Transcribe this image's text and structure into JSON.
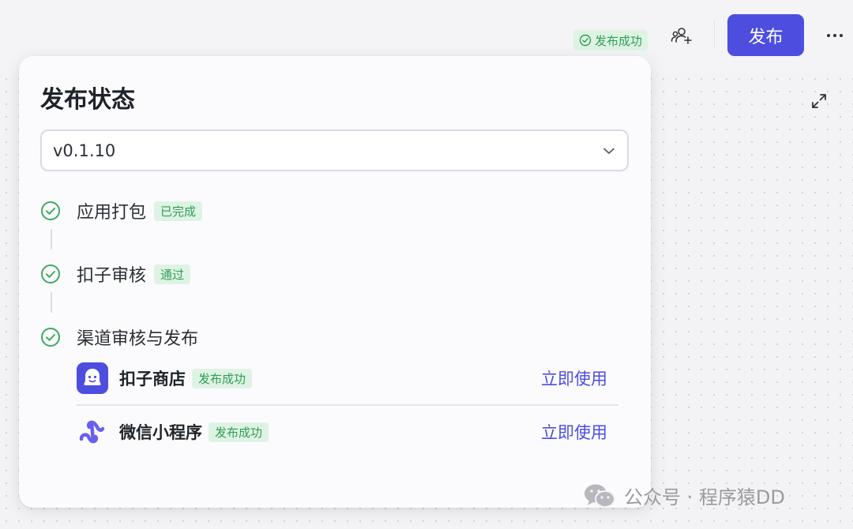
{
  "header": {
    "status_badge": "发布成功",
    "publish_button": "发布"
  },
  "panel": {
    "title": "发布状态",
    "version": "v0.1.10",
    "steps": [
      {
        "label": "应用打包",
        "tag": "已完成"
      },
      {
        "label": "扣子审核",
        "tag": "通过"
      },
      {
        "label": "渠道审核与发布"
      }
    ],
    "channels": [
      {
        "name": "扣子商店",
        "tag": "发布成功",
        "action": "立即使用"
      },
      {
        "name": "微信小程序",
        "tag": "发布成功",
        "action": "立即使用"
      }
    ]
  },
  "watermark": "公众号 · 程序猿DD",
  "colors": {
    "accent": "#4d4ee0",
    "success": "#2f9e55",
    "success_bg": "#dff3e4"
  },
  "icons": [
    "check-circle-icon",
    "add-user-icon",
    "more-icon",
    "expand-icon",
    "chevron-down-icon",
    "coze-store-logo",
    "wechat-miniprogram-logo",
    "wechat-icon"
  ]
}
